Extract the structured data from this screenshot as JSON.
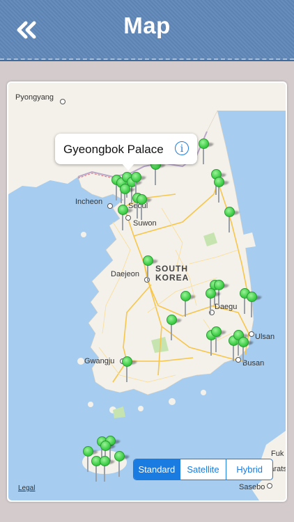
{
  "nav": {
    "title": "Map",
    "back_icon": "double-chevron-left-icon"
  },
  "map": {
    "places": {
      "pyongyang": "Pyongyang",
      "incheon": "Incheon",
      "seoul": "Seoul",
      "suwon": "Suwon",
      "daejeon": "Daejeon",
      "south_korea": "SOUTH KOREA",
      "daegu": "Daegu",
      "ulsan": "Ulsan",
      "busan": "Busan",
      "gwangju": "Gwangju",
      "sasebo": "Sasebo",
      "fukuoka": "Fuk",
      "karatsu": "Karatsu"
    },
    "legal": "Legal",
    "callout": {
      "title": "Gyeongbok Palace"
    },
    "map_types": [
      "Standard",
      "Satellite",
      "Hybrid"
    ],
    "selected_map_type": "Standard",
    "colors": {
      "pin": "#3fcf48",
      "accent": "#1a7be0",
      "nav": "#5f87b8"
    }
  }
}
